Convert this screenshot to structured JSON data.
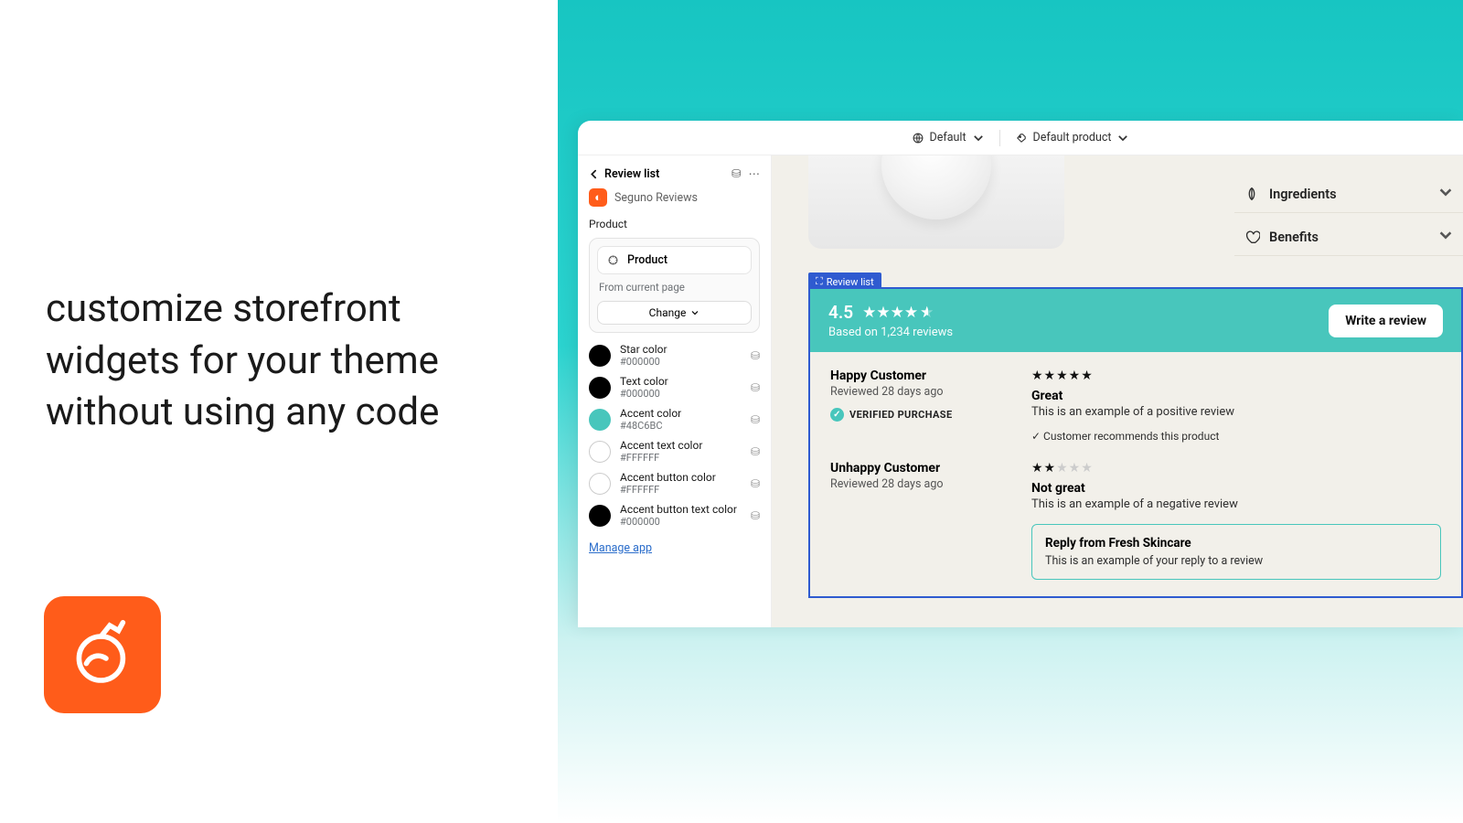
{
  "hero": "customize storefront widgets for your theme without using any code",
  "topbar": {
    "theme": "Default",
    "product": "Default product"
  },
  "sidebar": {
    "back": "Review list",
    "app": "Seguno Reviews",
    "section": "Product",
    "chip": "Product",
    "chip_sub": "From current page",
    "change": "Change",
    "colors": [
      {
        "name": "Star color",
        "hex": "#000000",
        "swatch": "#000000"
      },
      {
        "name": "Text color",
        "hex": "#000000",
        "swatch": "#000000"
      },
      {
        "name": "Accent color",
        "hex": "#48C6BC",
        "swatch": "#48C6BC"
      },
      {
        "name": "Accent text color",
        "hex": "#FFFFFF",
        "swatch": "#FFFFFF"
      },
      {
        "name": "Accent button color",
        "hex": "#FFFFFF",
        "swatch": "#FFFFFF"
      },
      {
        "name": "Accent button text color",
        "hex": "#000000",
        "swatch": "#000000"
      }
    ],
    "link": "Manage app"
  },
  "accordion": [
    {
      "label": "Ingredients"
    },
    {
      "label": "Benefits"
    }
  ],
  "rv_tag": "Review list",
  "rv": {
    "score": "4.5",
    "count": "Based on 1,234 reviews",
    "cta": "Write a review",
    "reviews": [
      {
        "name": "Happy Customer",
        "date": "Reviewed 28 days ago",
        "verified": "VERIFIED PURCHASE",
        "stars": 5,
        "title": "Great",
        "body": "This is an example of a positive review",
        "rec": "Customer recommends this product"
      },
      {
        "name": "Unhappy Customer",
        "date": "Reviewed 28 days ago",
        "stars": 2,
        "title": "Not great",
        "body": "This is an example of a negative review",
        "reply_t": "Reply from Fresh Skincare",
        "reply_b": "This is an example of your reply to a review"
      }
    ]
  }
}
